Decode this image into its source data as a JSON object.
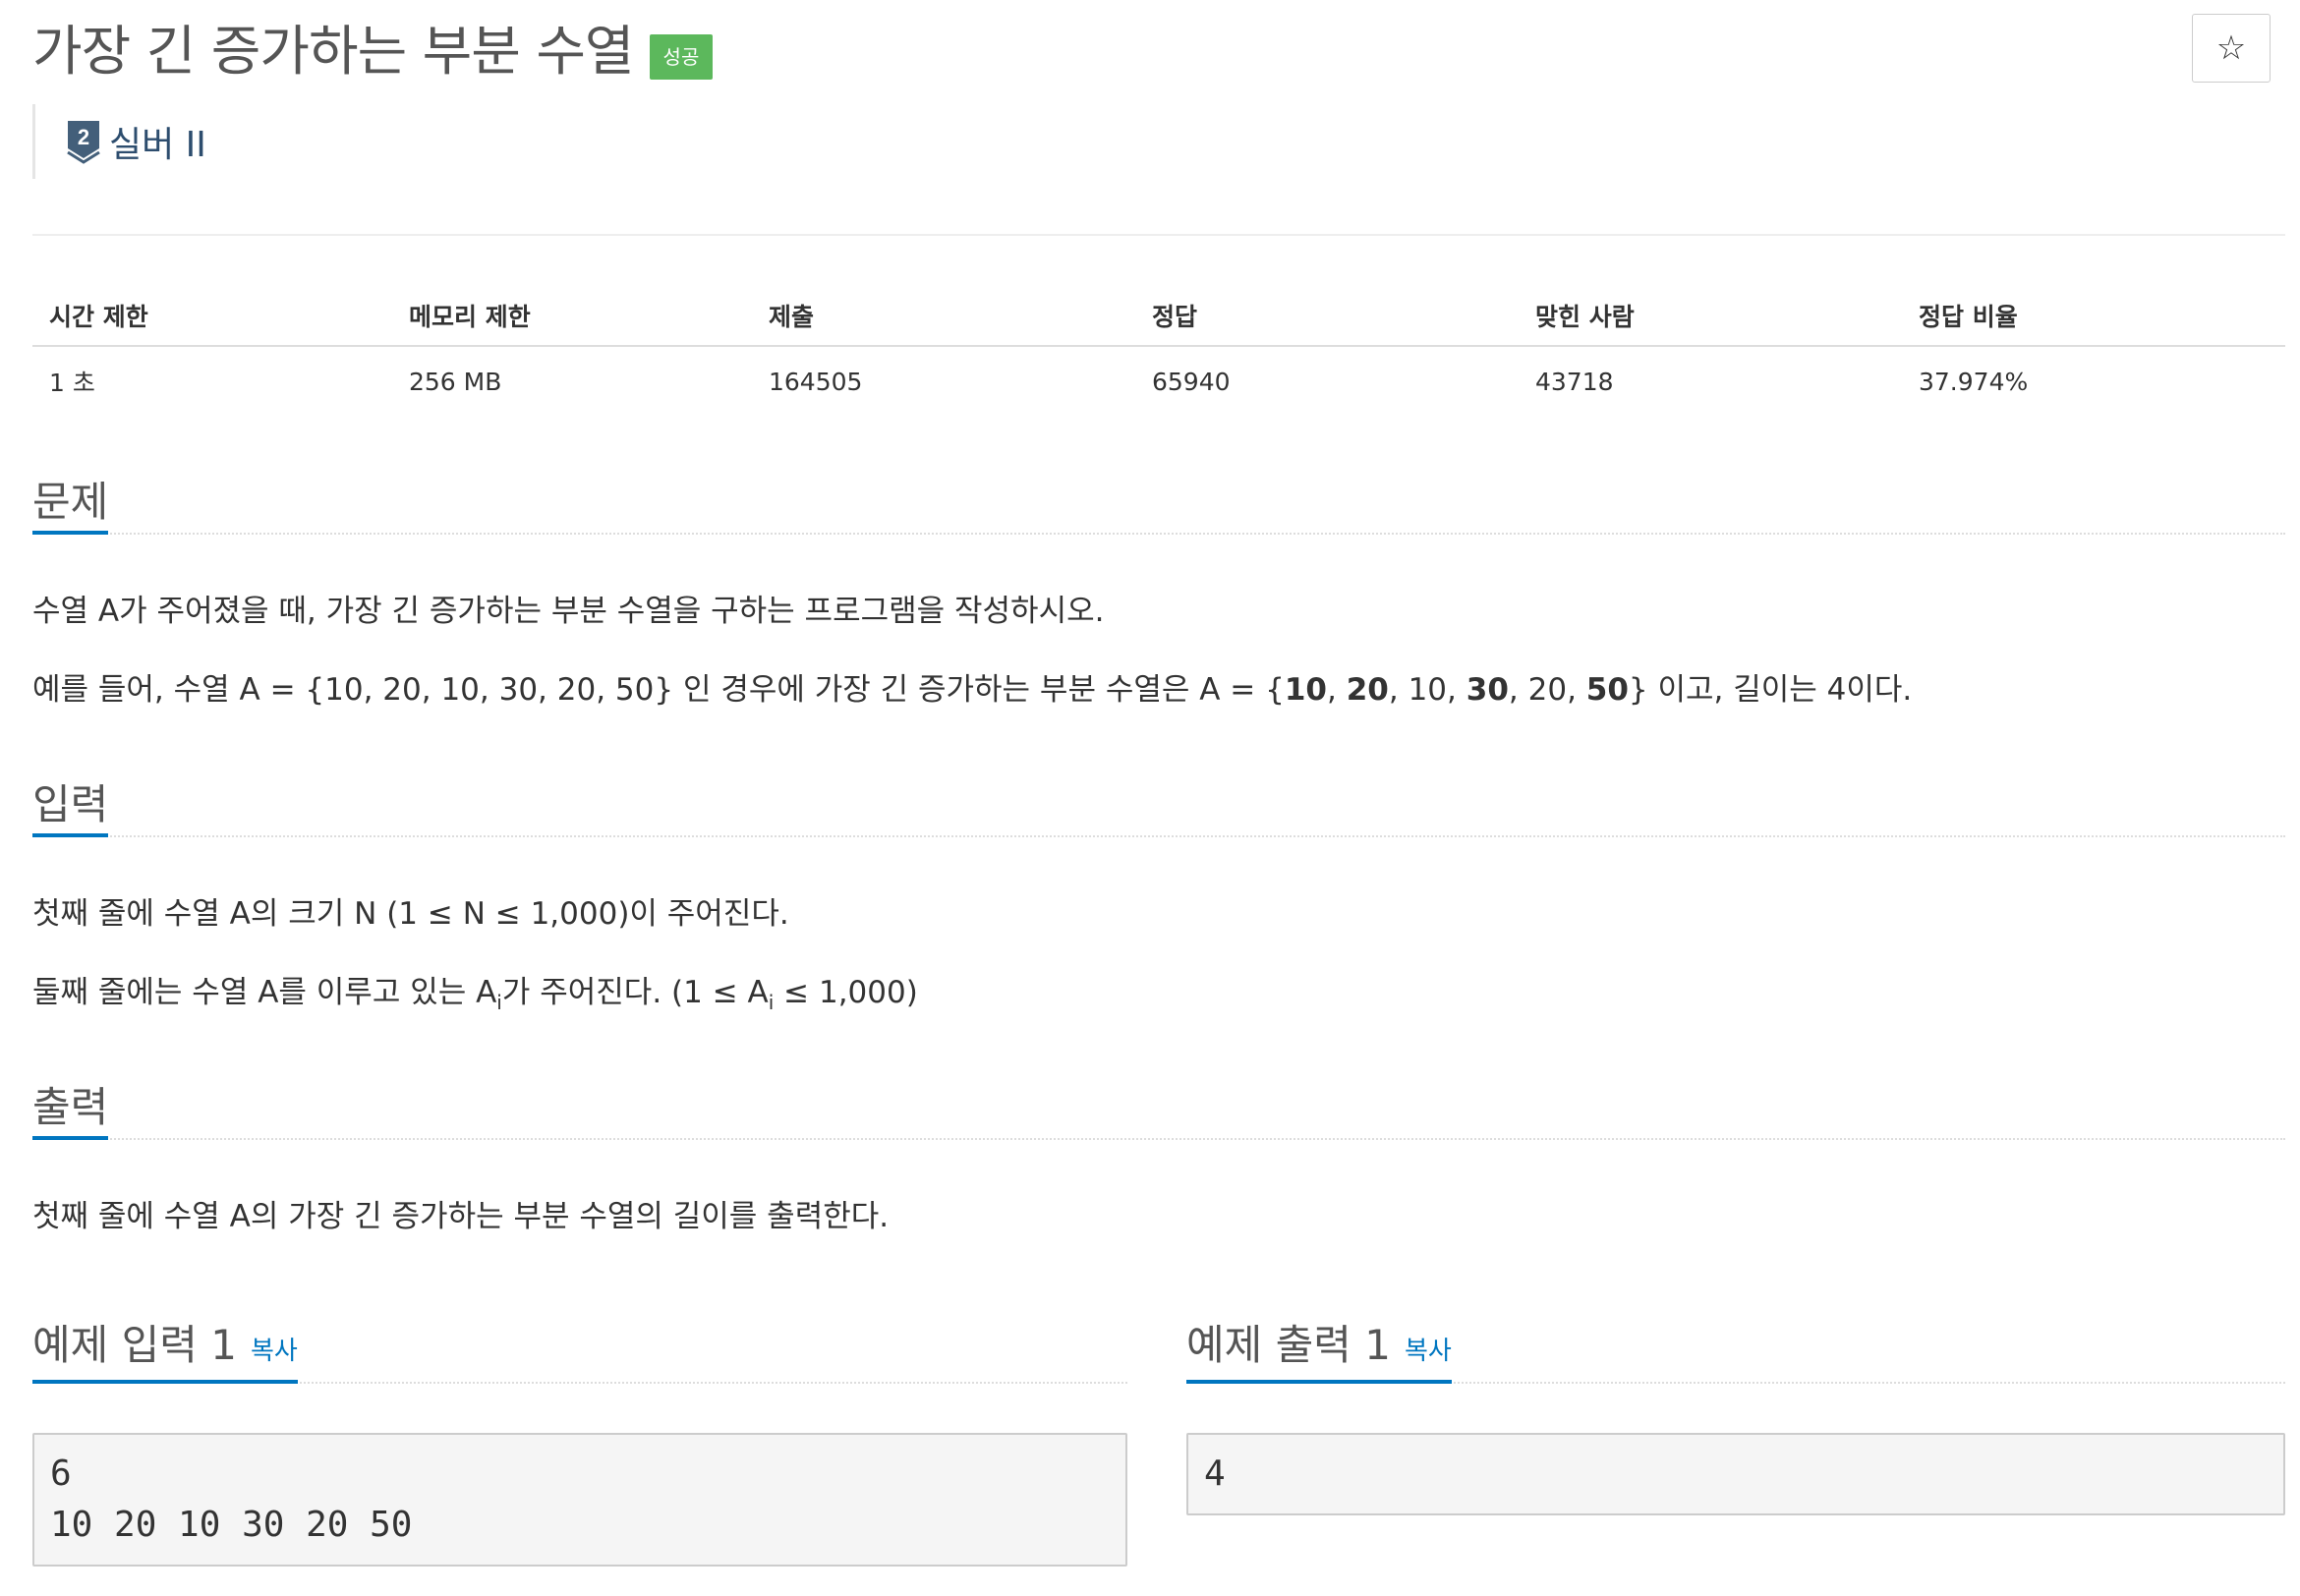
{
  "header": {
    "title": "가장 긴 증가하는 부분 수열",
    "status_badge": "성공",
    "star_icon": "☆",
    "tier": {
      "number": "2",
      "label": "실버 II",
      "color": "#2d4d6e"
    }
  },
  "stats": {
    "headers": [
      "시간 제한",
      "메모리 제한",
      "제출",
      "정답",
      "맞힌 사람",
      "정답 비율"
    ],
    "values": [
      "1 초",
      "256 MB",
      "164505",
      "65940",
      "43718",
      "37.974%"
    ]
  },
  "problem": {
    "heading": "문제",
    "line1": "수열 A가 주어졌을 때, 가장 긴 증가하는 부분 수열을 구하는 프로그램을 작성하시오.",
    "line2_prefix": "예를 들어, 수열 A = {10, 20, 10, 30, 20, 50} 인 경우에 가장 긴 증가하는 부분 수열은 A = {",
    "seq": [
      {
        "v": "10",
        "bold": true
      },
      {
        "v": "20",
        "bold": true
      },
      {
        "v": "10",
        "bold": false
      },
      {
        "v": "30",
        "bold": true
      },
      {
        "v": "20",
        "bold": false
      },
      {
        "v": "50",
        "bold": true
      }
    ],
    "line2_suffix": "} 이고, 길이는 4이다."
  },
  "input": {
    "heading": "입력",
    "line1": "첫째 줄에 수열 A의 크기 N (1 ≤ N ≤ 1,000)이 주어진다.",
    "line2_a": "둘째 줄에는 수열 A를 이루고 있는 A",
    "line2_sub": "i",
    "line2_b": "가 주어진다. (1 ≤ A",
    "line2_sub2": "i",
    "line2_c": " ≤ 1,000)"
  },
  "output": {
    "heading": "출력",
    "line1": "첫째 줄에 수열 A의 가장 긴 증가하는 부분 수열의 길이를 출력한다."
  },
  "sample_input": {
    "title": "예제 입력 1",
    "copy": "복사",
    "lines": [
      "6",
      "10 20 10 30 20 50"
    ]
  },
  "sample_output": {
    "title": "예제 출력 1",
    "copy": "복사",
    "lines": [
      "4"
    ]
  },
  "colors": {
    "accent": "#0076c0",
    "success": "#5cb85c"
  }
}
